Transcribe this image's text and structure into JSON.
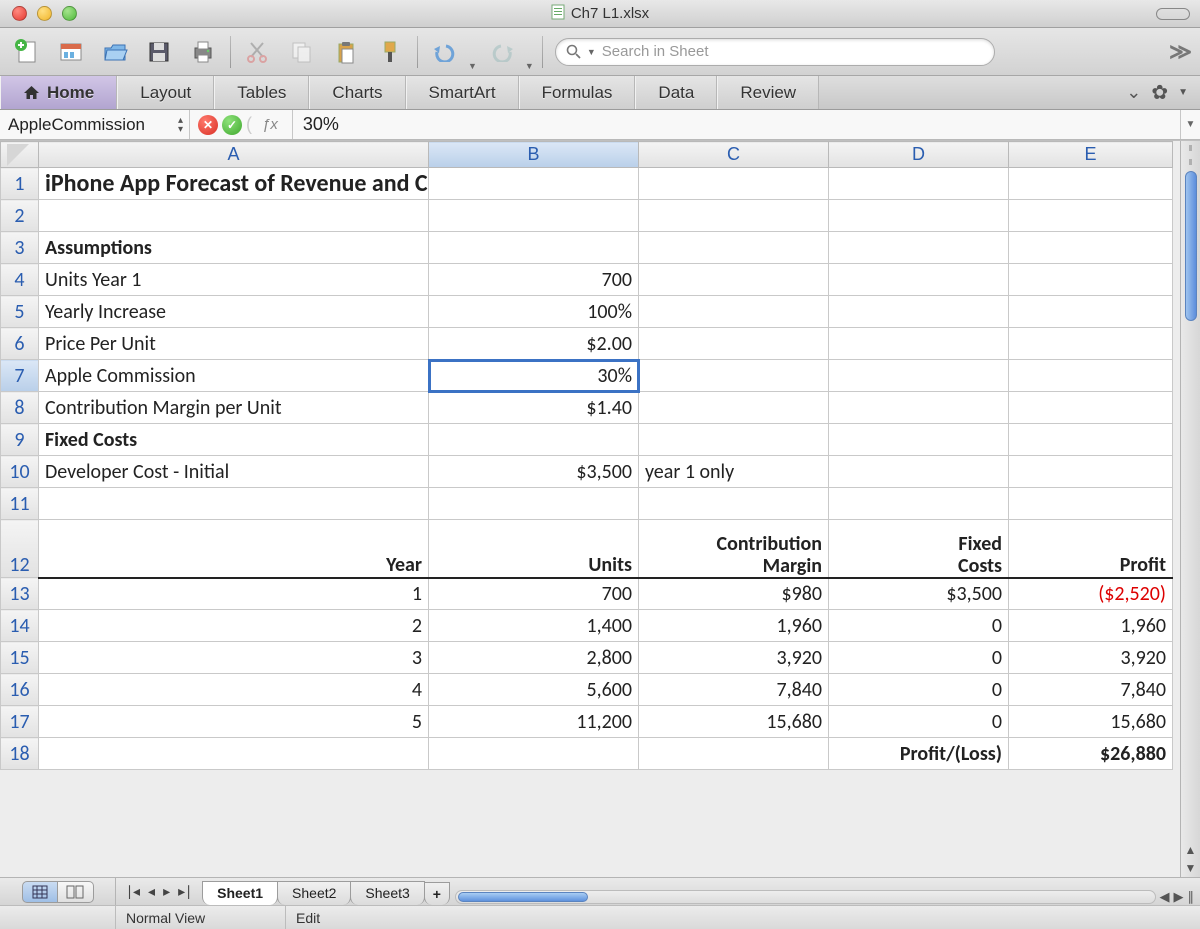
{
  "window": {
    "filename": "Ch7 L1.xlsx"
  },
  "toolbar": {
    "search_placeholder": "Search in Sheet"
  },
  "ribbon": {
    "tabs": [
      "Home",
      "Layout",
      "Tables",
      "Charts",
      "SmartArt",
      "Formulas",
      "Data",
      "Review"
    ],
    "active": 0
  },
  "formula_bar": {
    "name_box": "AppleCommission",
    "value": "30%"
  },
  "columns": [
    "A",
    "B",
    "C",
    "D",
    "E"
  ],
  "selected_cell": {
    "row": 7,
    "col": "B"
  },
  "rows": [
    {
      "n": 1,
      "A": "iPhone App Forecast of Revenue and Costs",
      "bold": true
    },
    {
      "n": 2
    },
    {
      "n": 3,
      "A": "Assumptions",
      "bold": true
    },
    {
      "n": 4,
      "A": "Units Year 1",
      "B": "700"
    },
    {
      "n": 5,
      "A": "Yearly Increase",
      "B": "100%"
    },
    {
      "n": 6,
      "A": "Price Per Unit",
      "B": "$2.00"
    },
    {
      "n": 7,
      "A": "Apple Commission",
      "B": "30%"
    },
    {
      "n": 8,
      "A": "Contribution Margin per Unit",
      "B": "$1.40"
    },
    {
      "n": 9,
      "A": "Fixed  Costs",
      "bold": true
    },
    {
      "n": 10,
      "A": "Developer Cost - Initial",
      "B": "$3,500",
      "C": "year 1 only"
    },
    {
      "n": 11
    }
  ],
  "table_header": {
    "row": 12,
    "A": "Year",
    "B": "Units",
    "C1": "Contribution",
    "C2": "Margin",
    "D1": "Fixed",
    "D2": "Costs",
    "E": "Profit"
  },
  "table_rows": [
    {
      "n": 13,
      "A": "1",
      "B": "700",
      "C": "$980",
      "D": "$3,500",
      "E": "($2,520)",
      "neg": true
    },
    {
      "n": 14,
      "A": "2",
      "B": "1,400",
      "C": "1,960",
      "D": "0",
      "E": "1,960"
    },
    {
      "n": 15,
      "A": "3",
      "B": "2,800",
      "C": "3,920",
      "D": "0",
      "E": "3,920"
    },
    {
      "n": 16,
      "A": "4",
      "B": "5,600",
      "C": "7,840",
      "D": "0",
      "E": "7,840"
    },
    {
      "n": 17,
      "A": "5",
      "B": "11,200",
      "C": "15,680",
      "D": "0",
      "E": "15,680"
    }
  ],
  "total_row": {
    "n": 18,
    "D": "Profit/(Loss)",
    "E": "$26,880"
  },
  "sheet_tabs": {
    "tabs": [
      "Sheet1",
      "Sheet2",
      "Sheet3"
    ],
    "active": 0
  },
  "status": {
    "view": "Normal View",
    "mode": "Edit"
  }
}
